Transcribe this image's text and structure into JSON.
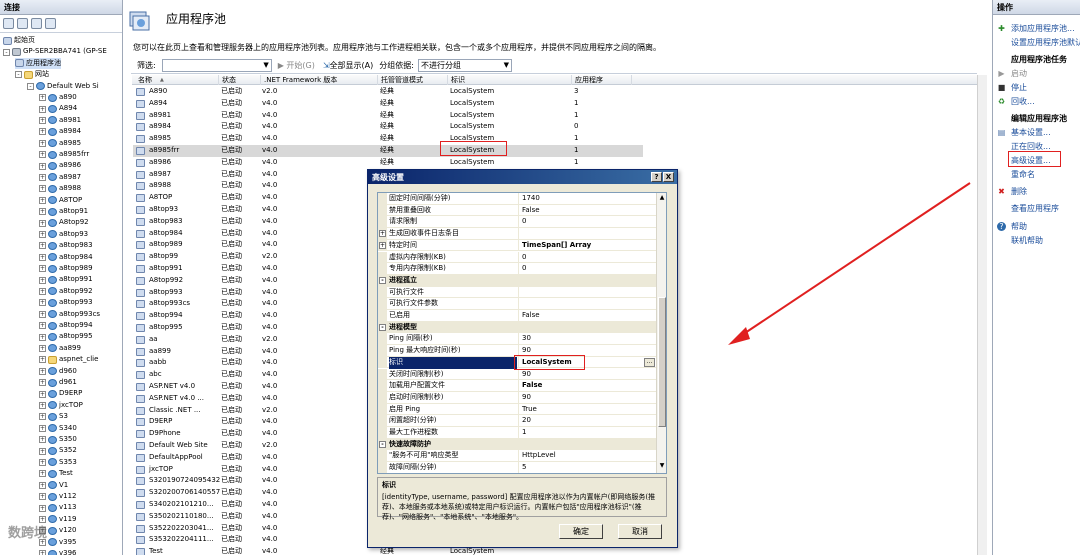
{
  "left_panel": {
    "header": "连接",
    "tree": [
      {
        "label": "起始页",
        "indent": 0,
        "exp": "",
        "icon": "page"
      },
      {
        "label": "GP-SER2BBA741 (GP-SE",
        "indent": 0,
        "exp": "-",
        "icon": "server"
      },
      {
        "label": "应用程序池",
        "indent": 1,
        "exp": "",
        "icon": "page",
        "selected": true
      },
      {
        "label": "网站",
        "indent": 1,
        "exp": "-",
        "icon": "folder"
      },
      {
        "label": "Default Web Si",
        "indent": 2,
        "exp": "-",
        "icon": "globe"
      },
      {
        "label": "a890",
        "indent": 3,
        "exp": "+",
        "icon": "globe"
      },
      {
        "label": "A894",
        "indent": 3,
        "exp": "+",
        "icon": "globe"
      },
      {
        "label": "a8981",
        "indent": 3,
        "exp": "+",
        "icon": "globe"
      },
      {
        "label": "a8984",
        "indent": 3,
        "exp": "+",
        "icon": "globe"
      },
      {
        "label": "a8985",
        "indent": 3,
        "exp": "+",
        "icon": "globe"
      },
      {
        "label": "a8985frr",
        "indent": 3,
        "exp": "+",
        "icon": "globe"
      },
      {
        "label": "a8986",
        "indent": 3,
        "exp": "+",
        "icon": "globe"
      },
      {
        "label": "a8987",
        "indent": 3,
        "exp": "+",
        "icon": "globe"
      },
      {
        "label": "a8988",
        "indent": 3,
        "exp": "+",
        "icon": "globe"
      },
      {
        "label": "A8TOP",
        "indent": 3,
        "exp": "+",
        "icon": "globe"
      },
      {
        "label": "a8top91",
        "indent": 3,
        "exp": "+",
        "icon": "globe"
      },
      {
        "label": "A8top92",
        "indent": 3,
        "exp": "+",
        "icon": "globe"
      },
      {
        "label": "a8top93",
        "indent": 3,
        "exp": "+",
        "icon": "globe"
      },
      {
        "label": "a8top983",
        "indent": 3,
        "exp": "+",
        "icon": "globe"
      },
      {
        "label": "a8top984",
        "indent": 3,
        "exp": "+",
        "icon": "globe"
      },
      {
        "label": "a8top989",
        "indent": 3,
        "exp": "+",
        "icon": "globe"
      },
      {
        "label": "a8top991",
        "indent": 3,
        "exp": "+",
        "icon": "globe"
      },
      {
        "label": "a8top992",
        "indent": 3,
        "exp": "+",
        "icon": "globe"
      },
      {
        "label": "a8top993",
        "indent": 3,
        "exp": "+",
        "icon": "globe"
      },
      {
        "label": "a8top993cs",
        "indent": 3,
        "exp": "+",
        "icon": "globe"
      },
      {
        "label": "a8top994",
        "indent": 3,
        "exp": "+",
        "icon": "globe"
      },
      {
        "label": "a8top995",
        "indent": 3,
        "exp": "+",
        "icon": "globe"
      },
      {
        "label": "aa899",
        "indent": 3,
        "exp": "+",
        "icon": "globe"
      },
      {
        "label": "aspnet_clie",
        "indent": 3,
        "exp": "+",
        "icon": "folder"
      },
      {
        "label": "d960",
        "indent": 3,
        "exp": "+",
        "icon": "globe"
      },
      {
        "label": "d961",
        "indent": 3,
        "exp": "+",
        "icon": "globe"
      },
      {
        "label": "D9ERP",
        "indent": 3,
        "exp": "+",
        "icon": "globe"
      },
      {
        "label": "jxcTOP",
        "indent": 3,
        "exp": "+",
        "icon": "globe"
      },
      {
        "label": "S3",
        "indent": 3,
        "exp": "+",
        "icon": "globe"
      },
      {
        "label": "S340",
        "indent": 3,
        "exp": "+",
        "icon": "globe"
      },
      {
        "label": "S350",
        "indent": 3,
        "exp": "+",
        "icon": "globe"
      },
      {
        "label": "S352",
        "indent": 3,
        "exp": "+",
        "icon": "globe"
      },
      {
        "label": "S353",
        "indent": 3,
        "exp": "+",
        "icon": "globe"
      },
      {
        "label": "Test",
        "indent": 3,
        "exp": "+",
        "icon": "globe"
      },
      {
        "label": "V1",
        "indent": 3,
        "exp": "+",
        "icon": "globe"
      },
      {
        "label": "v112",
        "indent": 3,
        "exp": "+",
        "icon": "globe"
      },
      {
        "label": "v113",
        "indent": 3,
        "exp": "+",
        "icon": "globe"
      },
      {
        "label": "v119",
        "indent": 3,
        "exp": "+",
        "icon": "globe"
      },
      {
        "label": "v120",
        "indent": 3,
        "exp": "+",
        "icon": "globe"
      },
      {
        "label": "v395",
        "indent": 3,
        "exp": "+",
        "icon": "globe"
      },
      {
        "label": "v396",
        "indent": 3,
        "exp": "+",
        "icon": "globe"
      },
      {
        "label": "v3981",
        "indent": 3,
        "exp": "+",
        "icon": "globe"
      }
    ]
  },
  "main": {
    "title": "应用程序池",
    "description": "您可以在此页上查看和管理服务器上的应用程序池列表。应用程序池与工作进程相关联，包含一个或多个应用程序，并提供不同应用程序之间的隔离。",
    "filter_label": "筛选:",
    "filter_value": "",
    "start_button": "开始(G)",
    "show_all_button": "全部显示(A)",
    "group_by_label": "分组依据:",
    "group_by_value": "不进行分组",
    "columns": [
      "名称",
      "状态",
      ".NET Framework 版本",
      "托管管道模式",
      "标识",
      "应用程序"
    ],
    "rows": [
      [
        "A890",
        "已启动",
        "v2.0",
        "经典",
        "LocalSystem",
        "3"
      ],
      [
        "A894",
        "已启动",
        "v4.0",
        "经典",
        "LocalSystem",
        "1"
      ],
      [
        "a8981",
        "已启动",
        "v4.0",
        "经典",
        "LocalSystem",
        "1"
      ],
      [
        "a8984",
        "已启动",
        "v4.0",
        "经典",
        "LocalSystem",
        "0"
      ],
      [
        "a8985",
        "已启动",
        "v4.0",
        "经典",
        "LocalSystem",
        "1"
      ],
      [
        "a8985frr",
        "已启动",
        "v4.0",
        "经典",
        "LocalSystem",
        "1"
      ],
      [
        "a8986",
        "已启动",
        "v4.0",
        "经典",
        "LocalSystem",
        "1"
      ],
      [
        "a8987",
        "已启动",
        "v4.0",
        "",
        "",
        ""
      ],
      [
        "a8988",
        "已启动",
        "v4.0",
        "",
        "",
        ""
      ],
      [
        "A8TOP",
        "已启动",
        "v4.0",
        "",
        "",
        ""
      ],
      [
        "a8top93",
        "已启动",
        "v4.0",
        "",
        "",
        ""
      ],
      [
        "a8top983",
        "已启动",
        "v4.0",
        "",
        "",
        ""
      ],
      [
        "a8top984",
        "已启动",
        "v4.0",
        "",
        "",
        ""
      ],
      [
        "a8top989",
        "已启动",
        "v4.0",
        "",
        "",
        ""
      ],
      [
        "a8top99",
        "已启动",
        "v2.0",
        "",
        "",
        ""
      ],
      [
        "a8top991",
        "已启动",
        "v4.0",
        "",
        "",
        ""
      ],
      [
        "A8top992",
        "已启动",
        "v4.0",
        "",
        "",
        ""
      ],
      [
        "a8top993",
        "已启动",
        "v4.0",
        "",
        "",
        ""
      ],
      [
        "a8top993cs",
        "已启动",
        "v4.0",
        "",
        "",
        ""
      ],
      [
        "a8top994",
        "已启动",
        "v4.0",
        "",
        "",
        ""
      ],
      [
        "a8top995",
        "已启动",
        "v4.0",
        "",
        "",
        ""
      ],
      [
        "aa",
        "已启动",
        "v2.0",
        "",
        "",
        ""
      ],
      [
        "aa899",
        "已启动",
        "v4.0",
        "",
        "",
        ""
      ],
      [
        "aabb",
        "已启动",
        "v4.0",
        "",
        "",
        ""
      ],
      [
        "abc",
        "已启动",
        "v4.0",
        "",
        "",
        ""
      ],
      [
        "ASP.NET v4.0",
        "已启动",
        "v4.0",
        "",
        "",
        ""
      ],
      [
        "ASP.NET v4.0 ...",
        "已启动",
        "v4.0",
        "",
        "",
        ""
      ],
      [
        "Classic .NET ...",
        "已启动",
        "v2.0",
        "",
        "",
        ""
      ],
      [
        "D9ERP",
        "已启动",
        "v4.0",
        "",
        "",
        ""
      ],
      [
        "D9Phone",
        "已启动",
        "v4.0",
        "",
        "",
        ""
      ],
      [
        "Default Web Site",
        "已启动",
        "v2.0",
        "",
        "",
        ""
      ],
      [
        "DefaultAppPool",
        "已启动",
        "v4.0",
        "",
        "",
        ""
      ],
      [
        "jxcTOP",
        "已启动",
        "v4.0",
        "",
        "",
        ""
      ],
      [
        "S320190724095432",
        "已启动",
        "v4.0",
        "",
        "",
        ""
      ],
      [
        "S320200706140557",
        "已启动",
        "v4.0",
        "",
        "",
        ""
      ],
      [
        "S340202101210...",
        "已启动",
        "v4.0",
        "",
        "",
        ""
      ],
      [
        "S350202110180...",
        "已启动",
        "v4.0",
        "",
        "",
        ""
      ],
      [
        "S352202203041...",
        "已启动",
        "v4.0",
        "",
        "",
        ""
      ],
      [
        "S353202204111...",
        "已启动",
        "v4.0",
        "",
        "",
        ""
      ],
      [
        "Test",
        "已启动",
        "v4.0",
        "经典",
        "LocalSystem",
        ""
      ]
    ]
  },
  "dialog": {
    "title": "高级设置",
    "help_btn": "?",
    "close_btn": "X",
    "props": [
      {
        "name": "固定时间间隔(分钟)",
        "value": "1740",
        "type": "prop"
      },
      {
        "name": "禁用重叠回收",
        "value": "False",
        "type": "prop"
      },
      {
        "name": "请求限制",
        "value": "0",
        "type": "prop"
      },
      {
        "name": "生成回收事件日志条目",
        "value": "",
        "type": "sub",
        "exp": "+"
      },
      {
        "name": "特定时间",
        "value": "TimeSpan[] Array",
        "type": "sub",
        "exp": "+",
        "bold": true
      },
      {
        "name": "虚拟内存限制(KB)",
        "value": "0",
        "type": "prop"
      },
      {
        "name": "专用内存限制(KB)",
        "value": "0",
        "type": "prop"
      },
      {
        "name": "进程孤立",
        "value": "",
        "type": "cat",
        "exp": "-"
      },
      {
        "name": "可执行文件",
        "value": "",
        "type": "prop"
      },
      {
        "name": "可执行文件参数",
        "value": "",
        "type": "prop"
      },
      {
        "name": "已启用",
        "value": "False",
        "type": "prop"
      },
      {
        "name": "进程模型",
        "value": "",
        "type": "cat",
        "exp": "-"
      },
      {
        "name": "Ping 间隔(秒)",
        "value": "30",
        "type": "prop"
      },
      {
        "name": "Ping 最大响应时间(秒)",
        "value": "90",
        "type": "prop"
      },
      {
        "name": "标识",
        "value": "LocalSystem",
        "type": "prop",
        "selected": true,
        "bold": true
      },
      {
        "name": "关闭时间限制(秒)",
        "value": "90",
        "type": "prop"
      },
      {
        "name": "加载用户配置文件",
        "value": "False",
        "type": "prop",
        "bold": true
      },
      {
        "name": "启动时间限制(秒)",
        "value": "90",
        "type": "prop"
      },
      {
        "name": "启用 Ping",
        "value": "True",
        "type": "prop"
      },
      {
        "name": "闲置超时(分钟)",
        "value": "20",
        "type": "prop"
      },
      {
        "name": "最大工作进程数",
        "value": "1",
        "type": "prop"
      },
      {
        "name": "快速故障防护",
        "value": "",
        "type": "cat",
        "exp": "-"
      },
      {
        "name": "\"服务不可用\"响应类型",
        "value": "HttpLevel",
        "type": "prop"
      },
      {
        "name": "故障间隔(分钟)",
        "value": "5",
        "type": "prop"
      }
    ],
    "ellipsis": "...",
    "desc_title": "标识",
    "desc_text": "[identityType, username, password] 配置应用程序池以作为内置帐户(即网络服务(推荐)、本地服务或本地系统)或特定用户标识运行。内置帐户包括\"应用程序池标识\"(推荐)、\"网络服务\"、\"本地系统\"、\"本地服务\"。",
    "ok": "确定",
    "cancel": "取消"
  },
  "right_panel": {
    "header": "操作",
    "items": [
      {
        "label": "添加应用程序池...",
        "kind": "link",
        "icon": "add-icon"
      },
      {
        "label": "设置应用程序池默认",
        "kind": "link",
        "icon": ""
      },
      {
        "label": "应用程序池任务",
        "kind": "section",
        "icon": ""
      },
      {
        "label": "启动",
        "kind": "disabled",
        "icon": "play-icon"
      },
      {
        "label": "停止",
        "kind": "link",
        "icon": "stop-icon"
      },
      {
        "label": "回收...",
        "kind": "link",
        "icon": "recycle-icon"
      },
      {
        "label": "编辑应用程序池",
        "kind": "section",
        "icon": ""
      },
      {
        "label": "基本设置...",
        "kind": "link",
        "icon": "settings-icon"
      },
      {
        "label": "正在回收...",
        "kind": "link",
        "icon": ""
      },
      {
        "label": "高级设置...",
        "kind": "link",
        "icon": ""
      },
      {
        "label": "重命名",
        "kind": "link",
        "icon": ""
      },
      {
        "label": "删除",
        "kind": "link",
        "icon": "delete-icon"
      },
      {
        "label": "查看应用程序",
        "kind": "link",
        "icon": ""
      },
      {
        "label": "帮助",
        "kind": "link",
        "icon": "help-icon"
      },
      {
        "label": "联机帮助",
        "kind": "link",
        "icon": ""
      }
    ]
  },
  "watermark": "数跨境",
  "colors": {
    "highlight_red": "#e02020",
    "link_blue": "#1a4c9a",
    "dialog_title": "#0a246a"
  }
}
